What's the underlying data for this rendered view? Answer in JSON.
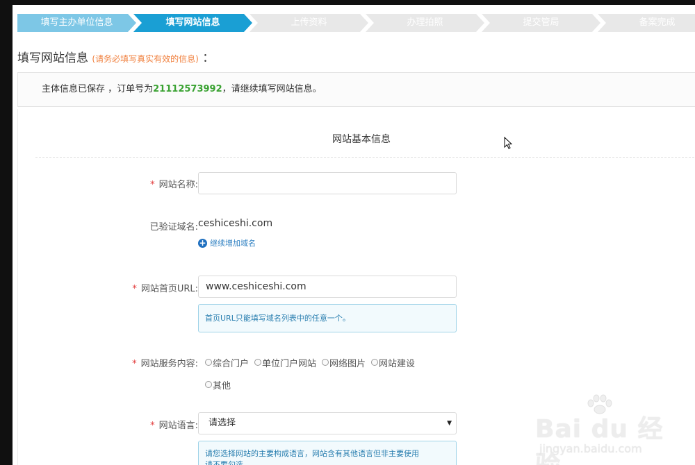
{
  "steps": [
    {
      "label": "填写主办单位信息",
      "state": "done"
    },
    {
      "label": "填写网站信息",
      "state": "active"
    },
    {
      "label": "上传资料",
      "state": "todo"
    },
    {
      "label": "办理拍照",
      "state": "todo"
    },
    {
      "label": "提交管局",
      "state": "todo"
    },
    {
      "label": "备案完成",
      "state": "todo"
    }
  ],
  "page": {
    "title": "填写网站信息",
    "hint": "(请务必填写真实有效的信息)",
    "colon": "："
  },
  "notice": {
    "prefix": "主体信息已保存 ，订单号为",
    "order_number": "21112573992",
    "suffix": "，请继续填写网站信息。"
  },
  "form": {
    "section_title": "网站基本信息",
    "required_mark": "*",
    "site_name": {
      "label": "网站名称:",
      "value": "",
      "placeholder": ""
    },
    "verified_domain": {
      "label": "已验证域名:",
      "value": "ceshiceshi.com"
    },
    "add_domain_label": "继续增加域名",
    "homepage_url": {
      "label": "网站首页URL:",
      "value": "www.ceshiceshi.com",
      "tip": "首页URL只能填写域名列表中的任意一个。"
    },
    "service_content": {
      "label": "网站服务内容:",
      "options": [
        "综合门户",
        "单位门户网站",
        "网络图片",
        "网站建设",
        "其他"
      ]
    },
    "language": {
      "label": "网站语言:",
      "selected": "请选择",
      "tip_line1": "请您选择网站的主要构成语言，网站含有其他语言但非主要使用",
      "tip_line2": "请不要勾选"
    }
  },
  "watermark": {
    "brand": "Bai du 经验",
    "url": "jingyan.baidu.com"
  },
  "colors": {
    "step_active": "#1a9fd4",
    "step_done": "#7dc7e6",
    "order_number": "#3aa232",
    "hint": "#f07f3c",
    "required": "#e23c3c"
  }
}
